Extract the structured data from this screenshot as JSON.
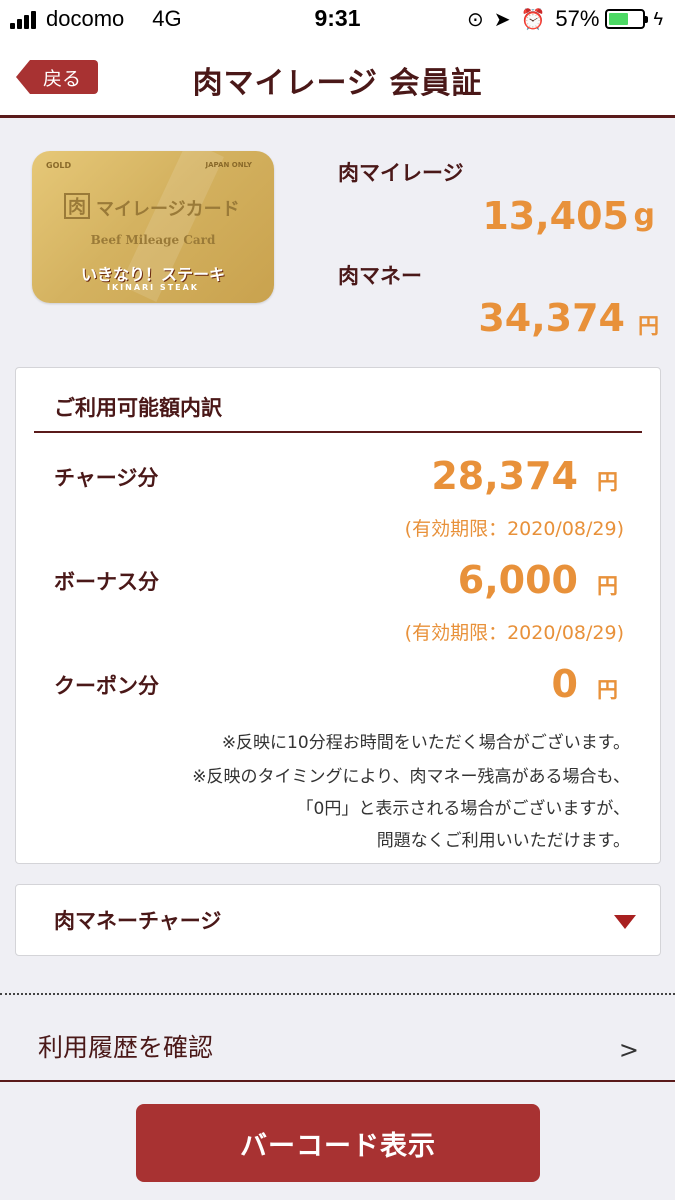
{
  "status_bar": {
    "carrier": "docomo",
    "network": "4G",
    "time": "9:31",
    "battery": "57%",
    "battery_level": 0.57,
    "icons": [
      "lock-rotation-icon",
      "location-arrow-icon",
      "alarm-icon",
      "battery-icon",
      "charging-bolt-icon"
    ]
  },
  "header": {
    "back_label": "戻る",
    "title": "肉マイレージ 会員証"
  },
  "card": {
    "gold": "GOLD",
    "japan_only": "JAPAN ONLY",
    "meat_glyph": "肉",
    "mileage_text": "マイレージカード",
    "beef_text": "Beef Mileage Card",
    "brand": "いきなり！ステーキ",
    "brand_sub": "IKINARI STEAK"
  },
  "balances": {
    "mileage_label": "肉マイレージ",
    "mileage_value": "13,405",
    "mileage_unit": "g",
    "money_label": "肉マネー",
    "money_value": "34,374",
    "money_unit": "円"
  },
  "breakdown": {
    "title": "ご利用可能額内訳",
    "rows": [
      {
        "label": "チャージ分",
        "value": "28,374",
        "unit": "円",
        "expiry": "(有効期限：2020/08/29)"
      },
      {
        "label": "ボーナス分",
        "value": "6,000",
        "unit": "円",
        "expiry": "(有効期限：2020/08/29)"
      },
      {
        "label": "クーポン分",
        "value": "0",
        "unit": "円"
      }
    ],
    "notes": [
      "※反映に10分程お時間をいただく場合がございます。",
      "※反映のタイミングにより、肉マネー残高がある場合も、",
      "「0円」と表示される場合がございますが、",
      "問題なくご利用いいただけます。"
    ]
  },
  "charge": {
    "label": "肉マネーチャージ"
  },
  "history": {
    "label": "利用履歴を確認",
    "chevron": ">"
  },
  "barcode_button": {
    "label": "バーコード表示"
  },
  "colors": {
    "accent": "#a83232",
    "brand_dark": "#4a1818",
    "value_orange": "#e8913a",
    "background": "#efeff4"
  }
}
